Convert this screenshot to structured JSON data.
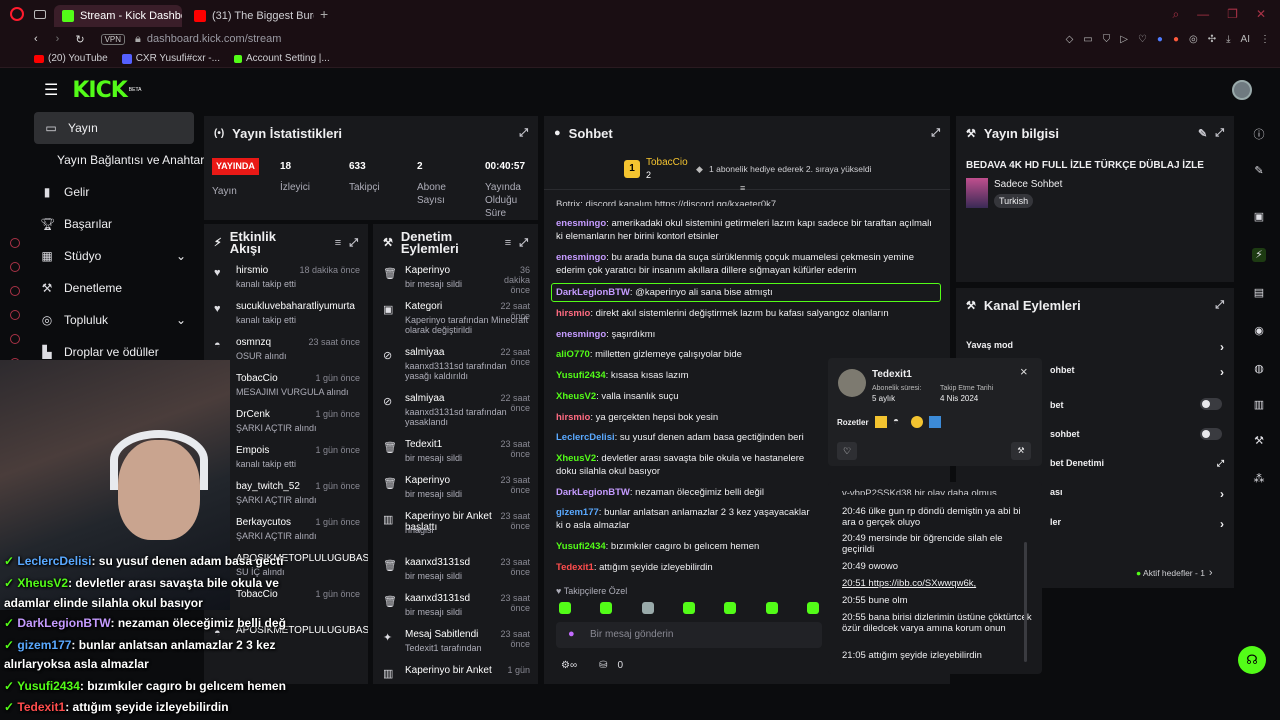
{
  "browser": {
    "tabs": [
      {
        "label": "Stream - Kick Dashboard",
        "active": true
      },
      {
        "label": "(31) The Biggest Burger W...",
        "active": false
      }
    ],
    "url": "dashboard.kick.com/stream",
    "vpn": "VPN",
    "ai": "AI",
    "bookmarks": [
      "(20) YouTube",
      "CXR Yusufi#cxr -...",
      "Account Setting |..."
    ]
  },
  "brand": {
    "logo": "KICK",
    "beta": "BETA"
  },
  "sidebar": {
    "items": [
      {
        "label": "Yayın",
        "icon": "video-icon"
      },
      {
        "label": "Yayın Bağlantısı ve Anahtarı",
        "icon": ""
      },
      {
        "label": "Gelir",
        "icon": "chart-icon"
      },
      {
        "label": "Başarılar",
        "icon": "trophy-icon"
      },
      {
        "label": "Stüdyo",
        "icon": "grid-icon"
      },
      {
        "label": "Denetleme",
        "icon": "wrench-icon"
      },
      {
        "label": "Topluluk",
        "icon": "people-icon"
      },
      {
        "label": "Droplar ve ödüller",
        "icon": "gift-icon"
      }
    ]
  },
  "stats": {
    "title": "Yayın İstatistikleri",
    "live_badge": "YAYINDA",
    "live_label": "Yayın",
    "viewers": "18",
    "viewers_label": "İzleyici",
    "followers": "633",
    "followers_label": "Takipçi",
    "subs": "2",
    "subs_label": "Abone Sayısı",
    "duration": "00:40:57",
    "duration_label": "Yayında Olduğu Süre"
  },
  "activity": {
    "title": "Etkinlik Akışı",
    "rows": [
      {
        "name": "hirsmio",
        "time": "18 dakika önce",
        "sub": "kanalı takip etti"
      },
      {
        "name": "sucukluvebaharatliyumurta",
        "time": "",
        "sub": "kanalı takip etti"
      },
      {
        "name": "osmnzq",
        "time": "23 saat önce",
        "sub": "OSUR alındı"
      },
      {
        "name": "TobacCio",
        "time": "1 gün önce",
        "sub": "MESAJIMI VURGULA alındı"
      },
      {
        "name": "DrCenk",
        "time": "1 gün önce",
        "sub": "ŞARKI AÇTIR alındı"
      },
      {
        "name": "Empois",
        "time": "1 gün önce",
        "sub": "kanalı takip etti"
      },
      {
        "name": "bay_twitch_52",
        "time": "1 gün önce",
        "sub": "ŞARKI AÇTIR alındı"
      },
      {
        "name": "Berkaycutos",
        "time": "1 gün önce",
        "sub": "ŞARKI AÇTIR alındı"
      },
      {
        "name": "APOSIKMETOPLULUGUBAS",
        "time": "",
        "sub": "SU İÇ alındı"
      },
      {
        "name": "TobacCio",
        "time": "1 gün önce",
        "sub": ""
      },
      {
        "name": "APOSIKMETOPLULUGUBAS",
        "time": "",
        "sub": ""
      }
    ]
  },
  "moderation": {
    "title": "Denetim Eylemleri",
    "rows": [
      {
        "name": "Kaperinyo",
        "time": "36 dakika önce",
        "sub": "bir mesajı sildi"
      },
      {
        "name": "Kategori",
        "time": "22 saat önce",
        "sub": "Kaperinyo tarafından Minecraft olarak değiştirildi"
      },
      {
        "name": "salmiyaa",
        "time": "22 saat önce",
        "sub": "kaanxd3131sd tarafından yasağı kaldırıldı"
      },
      {
        "name": "salmiyaa",
        "time": "22 saat önce",
        "sub": "kaanxd3131sd tarafından yasaklandı"
      },
      {
        "name": "Tedexit1",
        "time": "23 saat önce",
        "sub": "bir mesajı sildi"
      },
      {
        "name": "Kaperinyo",
        "time": "23 saat önce",
        "sub": "bir mesajı sildi"
      },
      {
        "name": "Kaperinyo bir Anket başlattı",
        "time": "23 saat önce",
        "sub": "hnagisi"
      },
      {
        "name": "kaanxd3131sd",
        "time": "23 saat önce",
        "sub": "bir mesajı sildi"
      },
      {
        "name": "kaanxd3131sd",
        "time": "23 saat önce",
        "sub": "bir mesajı sildi"
      },
      {
        "name": "Mesaj Sabitlendi",
        "time": "23 saat önce",
        "sub": "Tedexit1 tarafından"
      },
      {
        "name": "Kaperinyo bir Anket",
        "time": "1 gün",
        "sub": ""
      }
    ]
  },
  "chat": {
    "title": "Sohbet",
    "gifter": "TobacCio",
    "gifter_count": "2",
    "gift_text": "1 abonelik hediye ederek 2. sıraya yükseldi",
    "pinned_partial": "Botrix: discord kanalım https://discord.gg/kxaeter0k7",
    "messages": [
      {
        "user": "enesmingo",
        "color": "#c59bff",
        "text": "amerikadaki okul sistemini getirmeleri lazım kapı sadece bir taraftan açılmalı ki elemanların her birini kontorl etsinler"
      },
      {
        "user": "enesmingo",
        "color": "#c59bff",
        "text": "bu arada buna da suça sürüklenmiş çoçuk muamelesi çekmesin yemine ederim çok yaratıcı bir insanım akıllara dillere sığmayan küfürler ederim"
      },
      {
        "user": "DarkLegionBTW",
        "color": "#c59bff",
        "text": "@kaperinyo ali sana bise atmıştı"
      },
      {
        "user": "hirsmio",
        "color": "#ff6b81",
        "text": "direkt akıl sistemlerini değiştirmek lazım bu kafası salyangoz olanların"
      },
      {
        "user": "enesmingo",
        "color": "#c59bff",
        "text": "şaşırdıkmı"
      },
      {
        "user": "aliO770",
        "color": "#53fc18",
        "text": "milletten gizlemeye çalışıyolar bide"
      },
      {
        "user": "Yusufi2434",
        "color": "#53fc18",
        "text": "kısasa kısas lazım"
      },
      {
        "user": "XheusV2",
        "color": "#53fc18",
        "text": "valla insanlık suçu"
      },
      {
        "user": "hirsmio",
        "color": "#ff6b81",
        "text": "ya gerçekten hepsi bok yesin"
      },
      {
        "user": "LeclercDelisi",
        "color": "#5aa9ff",
        "text": "su yusuf denen adam basa gectiğinden beri okul"
      },
      {
        "user": "XheusV2",
        "color": "#53fc18",
        "text": "devletler arası savaşta bile okula ve hastanelere doku silahla okul basıyor"
      },
      {
        "user": "DarkLegionBTW",
        "color": "#c59bff",
        "text": "nezaman öleceğimiz belli değil"
      },
      {
        "user": "gizem177",
        "color": "#5aa9ff",
        "text": "bunlar anlatsan anlamazlar 2 3 kez yaşayacaklar ki o asla almazlar"
      },
      {
        "user": "Yusufi2434",
        "color": "#53fc18",
        "text": "bızımkıler cagıro bı gelıcem hemen"
      },
      {
        "user": "Tedexit1",
        "color": "#ff4d4d",
        "text": "attığım şeyide izleyebilirdin"
      }
    ],
    "follower_only": "Takipçilere Özel",
    "input_placeholder": "Bir mesaj gönderin",
    "points": "0"
  },
  "popup": {
    "username": "Tedexit1",
    "sub_label": "Abonelik süresi:",
    "sub_value": "5 aylık",
    "follow_label": "Takip Etme Tarihi",
    "follow_value": "4 Nis 2024",
    "badges_label": "Rozetler",
    "close": "×",
    "messages": [
      "20:46 ülke gun rp döndü demiştin ya abi bi ara o gerçek oluyo",
      "20:49 mersinde bir öğrencide silah ele geçirildi",
      "20:49 owowo",
      "20:51 https://ibb.co/SXwwqw6k,",
      "20:55 bune olm",
      "20:55 bana birisi dizlerimin üstüne çöktürtcek özür diledcek varya amına korum onun",
      "21:05 attığım şeyide izleyebilirdin"
    ],
    "messages_partial": "v-vbpP2SSKd38 bir olay daha olmuş"
  },
  "info": {
    "title": "Yayın bilgisi",
    "stream_title": "BEDAVA 4K HD FULL İZLE TÜRKÇE DÜBLAJ İZLE",
    "category": "Sadece Sohbet",
    "tag": "Turkish"
  },
  "channel_actions": {
    "title": "Kanal Eylemleri",
    "items": [
      "Yavaş mod",
      "ohbet",
      "bet",
      "sohbet",
      "bet Denetimi",
      "ası",
      "ler"
    ],
    "goals": "Aktif hedefler - 1"
  },
  "overlay": {
    "lines": [
      {
        "user": "LeclercDelisi",
        "color": "#5aa9ff",
        "text": ": su yusuf denen adam basa gecti"
      },
      {
        "user": "XheusV2",
        "color": "#53fc18",
        "text": ": devletler arası savaşta bile okula ve"
      },
      {
        "user": "",
        "color": "#fff",
        "text": "adamlar elinde silahla okul basıyor"
      },
      {
        "user": "DarkLegionBTW",
        "color": "#c59bff",
        "text": ": nezaman öleceğimiz belli değ"
      },
      {
        "user": "gizem177",
        "color": "#5aa9ff",
        "text": ": bunlar anlatsan anlamazlar 2 3 kez"
      },
      {
        "user": "",
        "color": "#fff",
        "text": "alırlaryoksa asla almazlar"
      },
      {
        "user": "Yusufi2434",
        "color": "#53fc18",
        "text": ": bızımkıler cagıro bı gelıcem hemen"
      },
      {
        "user": "Tedexit1",
        "color": "#ff4d4d",
        "text": ": attığım şeyide izleyebilirdin"
      }
    ]
  },
  "colors": {
    "accent": "#53fc18",
    "panel": "#18191c",
    "bg": "#0b0c0e",
    "live": "#e91916"
  }
}
